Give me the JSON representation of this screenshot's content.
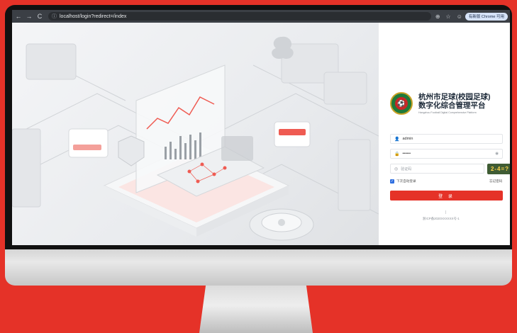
{
  "browser": {
    "url": "localhost/login?redirect=/index",
    "profile_label": "有新版 Chrome 可用"
  },
  "icons": {
    "back": "←",
    "forward": "→",
    "reload": "C",
    "info": "ⓘ",
    "zoom": "⊕",
    "star": "☆",
    "account": "☺",
    "user": "👤",
    "lock": "🔒",
    "shield": "◎",
    "eye": "◉",
    "check": "✓"
  },
  "brand": {
    "title_line1": "杭州市足球(校园足球)",
    "title_line2": "数字化综合管理平台",
    "subtitle": "Hangzhou Football Digital Comprehensive Platform"
  },
  "login": {
    "username_value": "admin",
    "password_value": "••••••",
    "captcha_placeholder": "验证码",
    "captcha_text": "2-4=?",
    "remember_label": "下次自动登录",
    "forgot_label": "忘记密码",
    "login_button": "登 录",
    "dot": "|",
    "footer": "浙ICP备2020XXXXXX号-1"
  },
  "colors": {
    "accent": "#e53228",
    "captcha_bg": "#3f5c34",
    "brand_green": "#1f7a3a"
  }
}
